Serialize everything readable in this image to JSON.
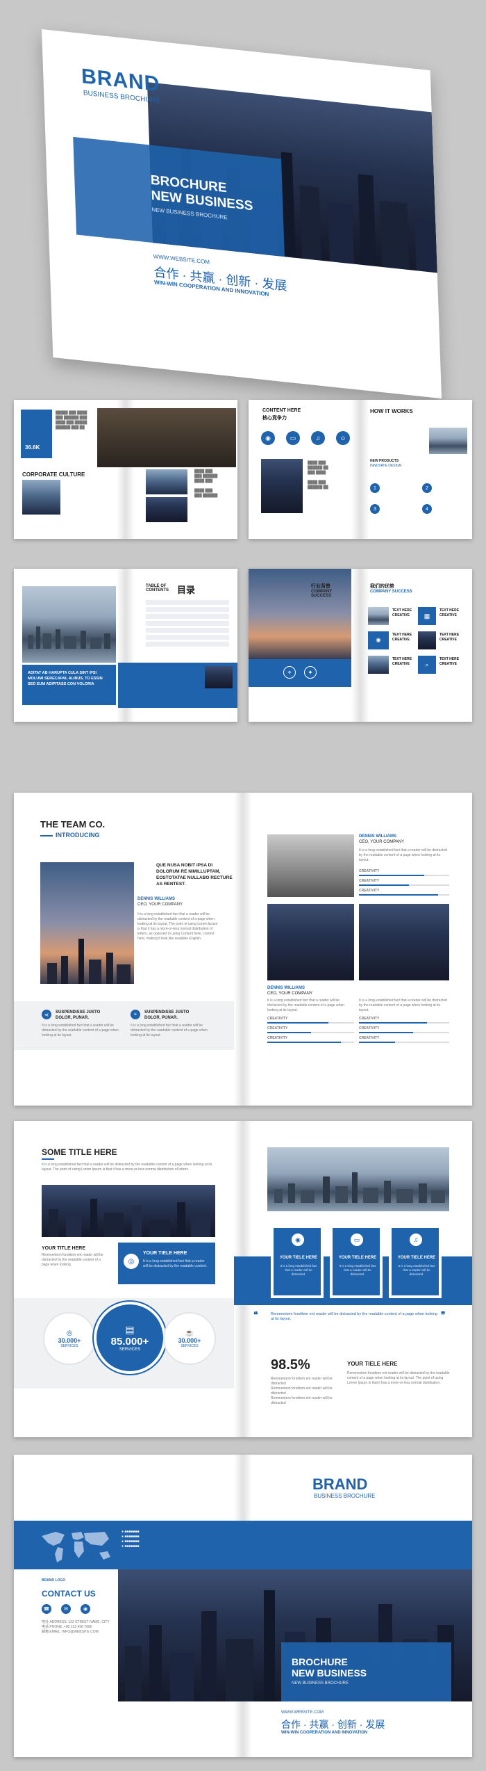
{
  "cover": {
    "brand": "BRAND",
    "brand_sub": "BUSINESS BROCHURE",
    "headline_1": "BROCHURE",
    "headline_2": "NEW BUSINESS",
    "headline_sub": "NEW BUSINESS BROCHURE",
    "website": "WWW.WEBSITE.COM",
    "slogan_cn": "合作 · 共赢 · 创新 · 发展",
    "slogan_en": "WIN-WIN COOPERATION AND INNOVATION"
  },
  "spread1": {
    "left_title": "CORPORATE CULTURE",
    "left_number": "36.6K",
    "right_title": "CONTENT HERE",
    "right_title_cn": "核心竞争力",
    "right2_title": "HOW IT WORKS",
    "right2_sub": "NEW PRODUCTS",
    "right2_sub2": "INNOVATE DESIGN",
    "steps": [
      "1",
      "2",
      "3",
      "4"
    ]
  },
  "spread2": {
    "toc_en": "TABLE OF CONTENTS",
    "toc_cn": "目录",
    "left_caption": "ADITAT AB HARUPTA CULA SINT IPSI MOLUMI SERECAPAL ALIBUS, TO ESSIN SED EUM ADIPITASS CON VOLORIA",
    "company_cn": "行业背景",
    "company_en": "COMPANY SUCCESS",
    "partner_cn": "我们的优势",
    "partner_en": "COMPANY SUCCESS",
    "feature_label": "TEXT HERE CREATIVE"
  },
  "team": {
    "title": "THE TEAM CO.",
    "subtitle": "INTRODUCING",
    "quote": "QUE NUSA NOBIT IPSA DI DOLORUM RE NIMILLUPTAM, EOSTOTATAE NULLABO RECTURE AS RENTEST.",
    "person_name": "DENNIS WILLIAMS",
    "person_role": "CEO, YOUR COMPANY",
    "body": "It is a long established fact that a reader will be distracted by the readable content of a page when looking at its layout. The point of using Lorem Ipsum is that it has a more-or-less normal distribution of letters, as opposed to using Content here, content here, making it look like readable English.",
    "feature_1": "SUSPENDISSE JUSTO DOLOR, PUNAR.",
    "feature_2": "SUSPENDISSE JUSTO DOLOR, PUNAR.",
    "feature_body": "It is a long established fact that a reader will be distracted by the readable content of a page when looking at its layout.",
    "right_name": "DENNIS WILLIAMS",
    "right_role": "CEO, YOUR COMPANY",
    "right_body": "It is a long established fact that a reader will be distracted by the readable content of a page when looking at its layout.",
    "bar_label": "CREATIVITY",
    "bar_labels": [
      "CREATIVITY",
      "CREATIVITY",
      "CREATIVITY"
    ],
    "bars_top": [
      0.72,
      0.55,
      0.88
    ],
    "bars_left": [
      0.7,
      0.5,
      0.85
    ],
    "bars_right": [
      0.75,
      0.6,
      0.4
    ]
  },
  "services": {
    "title": "SOME TITLE HERE",
    "body": "It is a long established fact that a reader will be distracted by the readable content of a page when looking at its layout. The point of using Lorem Ipsum is that it has a more-or-less normal distribution of letters.",
    "your_title": "YOUR TITLE HERE",
    "your_body": "Remmentem forsittem ent reader will be distracted by the readable content of a page when looking.",
    "blue_box_title": "YOUR TIELE HERE",
    "blue_box_body": "It is a long established fact that a reader will be distracted by the readable content.",
    "stat_left_value": "30.000+",
    "stat_left_label": "SERVICES",
    "stat_main_value": "85.000+",
    "stat_main_label": "SERVICES",
    "stat_right_value": "30.000+",
    "stat_right_label": "SERVICES",
    "cards": [
      {
        "title": "YOUR TIELE HERE",
        "body": "It is a long established fact that a reader will be distracted."
      },
      {
        "title": "YOUR TIELE HERE",
        "body": "It is a long established fact that a reader will be distracted."
      },
      {
        "title": "YOUR TIELE HERE",
        "body": "It is a long established fact that a reader will be distracted."
      }
    ],
    "quote": "Remmentem forsittem ent reader will be distracted by the readable content of a page when looking at its layout.",
    "percent": "98.5%",
    "percent_title": "YOUR TIELE HERE",
    "percent_body": "Remmentem forsittem ent reader will be distracted by the readable content of a page when looking at its layout. The point of using Lorem Ipsum is that it has a more-or-less normal distribution.",
    "bullets": [
      "Remmentem forsittem ent reader will be distracted",
      "Remmentem forsittem ent reader will be distracted",
      "Remmentem forsittem ent reader will be distracted"
    ]
  },
  "back": {
    "contact_title": "CONTACT US",
    "logo_text": "BRAND LOGO",
    "contact_lines": [
      "地址 ADDRESS: 123 STREET NAME, CITY",
      "电话 PHONE: +00 123 456 7890",
      "邮箱 EMAIL: INFO@WEBSITE.COM"
    ],
    "map_labels": [
      "●  ■■■■■■■",
      "●  ■■■■■■■",
      "●  ■■■■■■■",
      "●  ■■■■■■■"
    ],
    "brand": "BRAND",
    "brand_sub": "BUSINESS BROCHURE",
    "headline_1": "BROCHURE",
    "headline_2": "NEW BUSINESS",
    "headline_sub": "NEW BUSINESS BROCHURE",
    "website": "WWW.WEBSITE.COM",
    "slogan_cn": "合作 · 共赢 · 创新 · 发展",
    "slogan_en": "WIN-WIN COOPERATION AND INNOVATION"
  },
  "colors": {
    "accent": "#1f63ad",
    "page": "#ffffff",
    "background": "#c8c8c8"
  }
}
